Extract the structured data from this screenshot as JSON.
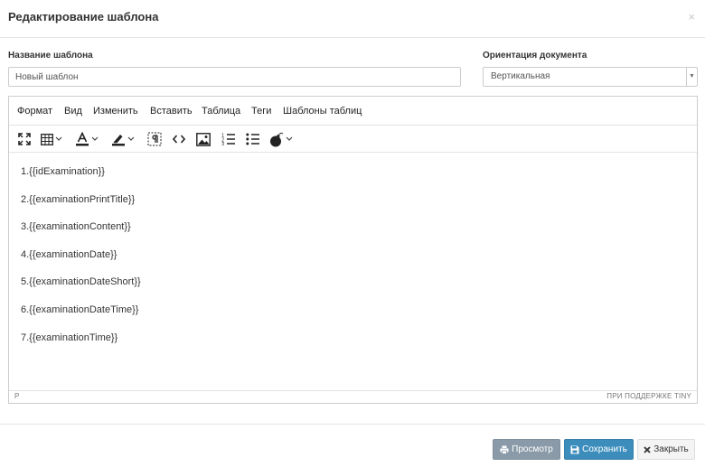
{
  "modal": {
    "title": "Редактирование шаблона",
    "close": "×"
  },
  "form": {
    "name_label": "Название шаблона",
    "name_value": "Новый шаблон",
    "orientation_label": "Ориентация документа",
    "orientation_value": "Вертикальная",
    "orientation_arrow": "▼"
  },
  "editor": {
    "menu": [
      "Формат",
      "Вид",
      "Изменить",
      "Вставить",
      "Таблица",
      "Теги",
      "Шаблоны таблиц"
    ],
    "toolbar_icons": [
      "fullscreen-icon",
      "table-icon",
      "text-color-icon",
      "highlight-icon",
      "nonbreaking-icon",
      "code-icon",
      "image-icon",
      "numbered-list-icon",
      "bullet-list-icon",
      "bomb-icon"
    ],
    "lines": [
      "1.{{idExamination}}",
      "2.{{examinationPrintTitle}}",
      "3.{{examinationContent}}",
      "4.{{examinationDate}}",
      "5.{{examinationDateShort}}",
      "6.{{examinationDateTime}}",
      "7.{{examinationTime}}"
    ],
    "status_path": "P",
    "status_brand": "ПРИ ПОДДЕРЖКЕ TINY"
  },
  "footer": {
    "preview_label": "Просмотр",
    "save_label": "Сохранить",
    "close_label": "Закрыть"
  },
  "colors": {
    "save": "#3c8dbc",
    "preview": "#8a9aa8",
    "close": "#f4f4f4"
  }
}
